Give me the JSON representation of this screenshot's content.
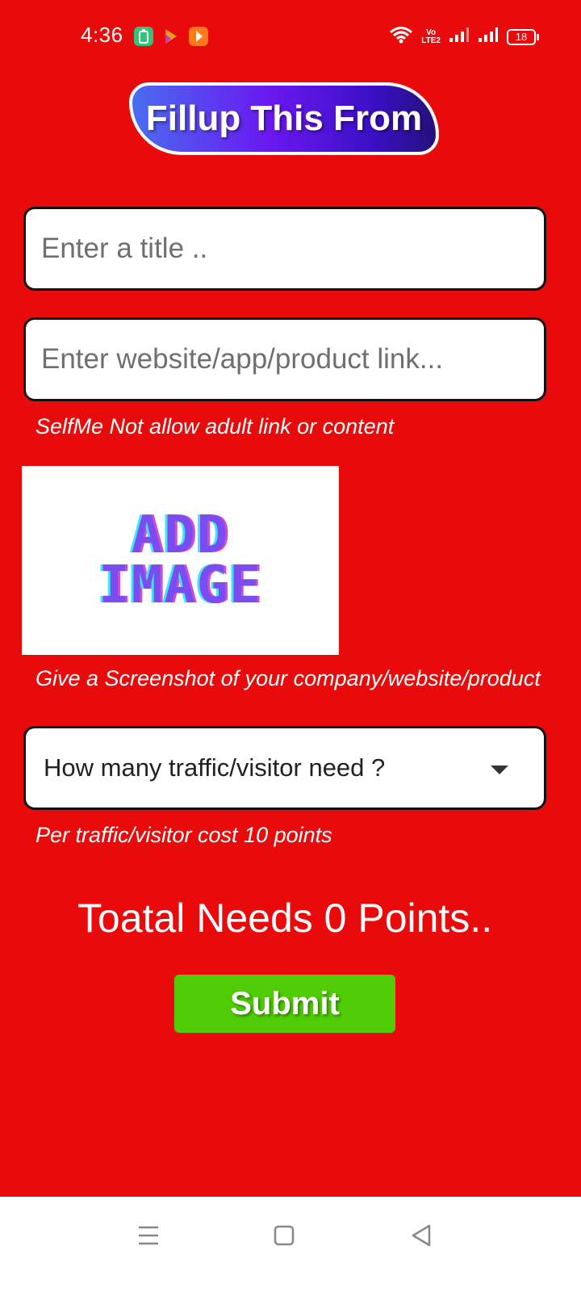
{
  "status_bar": {
    "time": "4:36",
    "volte_line1": "Vo",
    "volte_line2": "LTE2",
    "battery": "18"
  },
  "header": {
    "title": "Fillup This From"
  },
  "form": {
    "title_placeholder": "Enter a title ..",
    "link_placeholder": "Enter website/app/product link...",
    "link_note": "SelfMe Not allow adult link or content",
    "image_text_line1": "ADD",
    "image_text_line2": "IMAGE",
    "image_note": "Give a Screenshot of your company/website/product",
    "traffic_select_value": "How many traffic/visitor need ?",
    "traffic_note": "Per traffic/visitor cost 10 points",
    "total_text": "Toatal Needs 0 Points..",
    "submit_label": "Submit"
  },
  "colors": {
    "background": "#e90b0b",
    "submit": "#4fcc05",
    "header_gradient": [
      "#4a6cf0",
      "#6a18f0",
      "#24107a"
    ]
  },
  "icons": {
    "status_apps": [
      "battery-saver-icon",
      "media-app-icon",
      "video-app-icon"
    ],
    "status_right": [
      "wifi-icon",
      "volte-icon",
      "signal-icon",
      "signal-icon",
      "battery-icon"
    ],
    "nav": [
      "recent-apps-icon",
      "home-icon",
      "back-icon"
    ]
  }
}
